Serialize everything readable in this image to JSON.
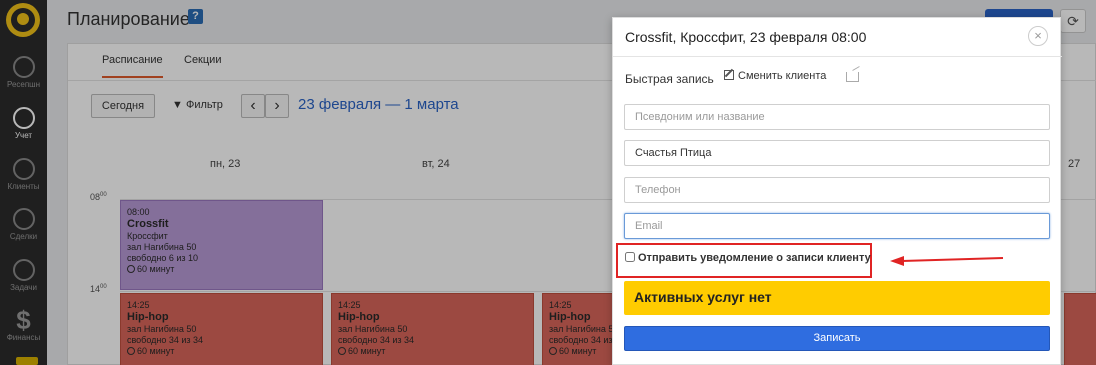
{
  "sidebar": {
    "items": [
      {
        "label": "Ресепшн",
        "icon": "home-icon"
      },
      {
        "label": "Учет",
        "icon": "calendar-icon"
      },
      {
        "label": "Клиенты",
        "icon": "person-icon"
      },
      {
        "label": "Сделки",
        "icon": "handshake-icon"
      },
      {
        "label": "Задачи",
        "icon": "tasks-icon"
      },
      {
        "label": "Финансы",
        "icon": "dollar-icon"
      }
    ]
  },
  "header": {
    "title": "Планирование",
    "help": "?"
  },
  "tabs": [
    {
      "label": "Расписание"
    },
    {
      "label": "Секции"
    }
  ],
  "toolbar": {
    "today": "Сегодня",
    "filter": "Фильтр",
    "prev": "‹",
    "next": "›",
    "range": "23 февраля — 1 марта"
  },
  "calendar": {
    "days": [
      "пн, 23",
      "вт, 24",
      "27"
    ],
    "times": [
      {
        "hour": "08",
        "min": "00"
      },
      {
        "hour": "14",
        "min": "00"
      }
    ],
    "events": [
      {
        "time": "08:00",
        "name": "Crossfit",
        "subtitle": "Кроссфит",
        "place": "зал Нагибина 50",
        "free": "свободно 6 из 10",
        "duration": "60 минут"
      },
      {
        "time": "14:25",
        "name": "Hip-hop",
        "place": "зал Нагибина 50",
        "free": "свободно 34 из 34",
        "duration": "60 минут"
      },
      {
        "time": "14:25",
        "name": "Hip-hop",
        "place": "зал Нагибина 50",
        "free": "свободно 34 из 34",
        "duration": "60 минут"
      },
      {
        "time": "14:25",
        "name": "Hip-hop",
        "place": "зал Нагибина 50",
        "free": "свободно 34 из 34",
        "duration": "60 минут"
      }
    ]
  },
  "modal": {
    "title": "Crossfit, Кроссфит, 23 февраля 08:00",
    "close": "×",
    "quick_record": "Быстрая запись",
    "change_client": "Сменить клиента",
    "fields": {
      "alias_placeholder": "Псевдоним или название",
      "name_value": "Счастья Птица",
      "phone_placeholder": "Телефон",
      "email_placeholder": "Email"
    },
    "notify_label": "Отправить уведомление о записи клиенту",
    "no_services": "Активных услуг нет",
    "submit": "Записать"
  },
  "colors": {
    "accent_blue": "#2f6de0",
    "warning_yellow": "#ffcc00",
    "event_purple": "#b89ad6",
    "event_red": "#d8665a",
    "annotation_red": "#e02424"
  }
}
